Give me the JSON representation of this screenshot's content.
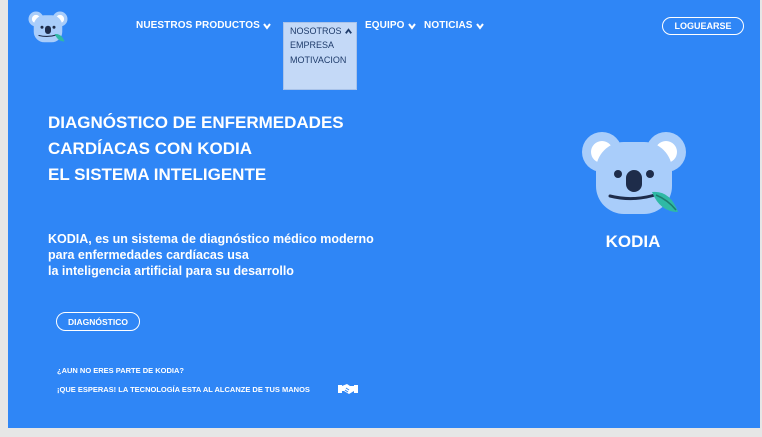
{
  "nav": {
    "products": "NUESTROS PRODUCTOS",
    "nosotros": "NOSOTROS",
    "equipo": "EQUIPO",
    "noticias": "NOTICIAS",
    "login": "LOGUEARSE"
  },
  "dropdown": {
    "items": [
      "EMPRESA",
      "MOTIVACION"
    ]
  },
  "hero": {
    "title_lines": [
      "DIAGNÓSTICO DE ENFERMEDADES",
      "CARDÍACAS CON KODIA",
      "EL SISTEMA INTELIGENTE"
    ],
    "description_lines": [
      "KODIA, es un sistema de diagnóstico médico moderno",
      "para enfermedades cardíacas usa",
      "la inteligencia artificial para su desarrollo"
    ],
    "button": "DIAGNÓSTICO",
    "note1": "¿AUN NO ERES PARTE DE KODIA?",
    "note2": "¡QUE ESPERAS! LA TECNOLOGÍA ESTA AL ALCANZE DE TUS MANOS",
    "brand": "KODIA"
  },
  "icons": {
    "logo": "koala-logo-icon",
    "chevron": "chevron-down-icon",
    "chevron_up": "chevron-up-icon",
    "handshake": "handshake-icon"
  },
  "colors": {
    "background": "#2f86f6",
    "dropdown": "#c4d9f7",
    "koala": "#a9cdfa"
  }
}
